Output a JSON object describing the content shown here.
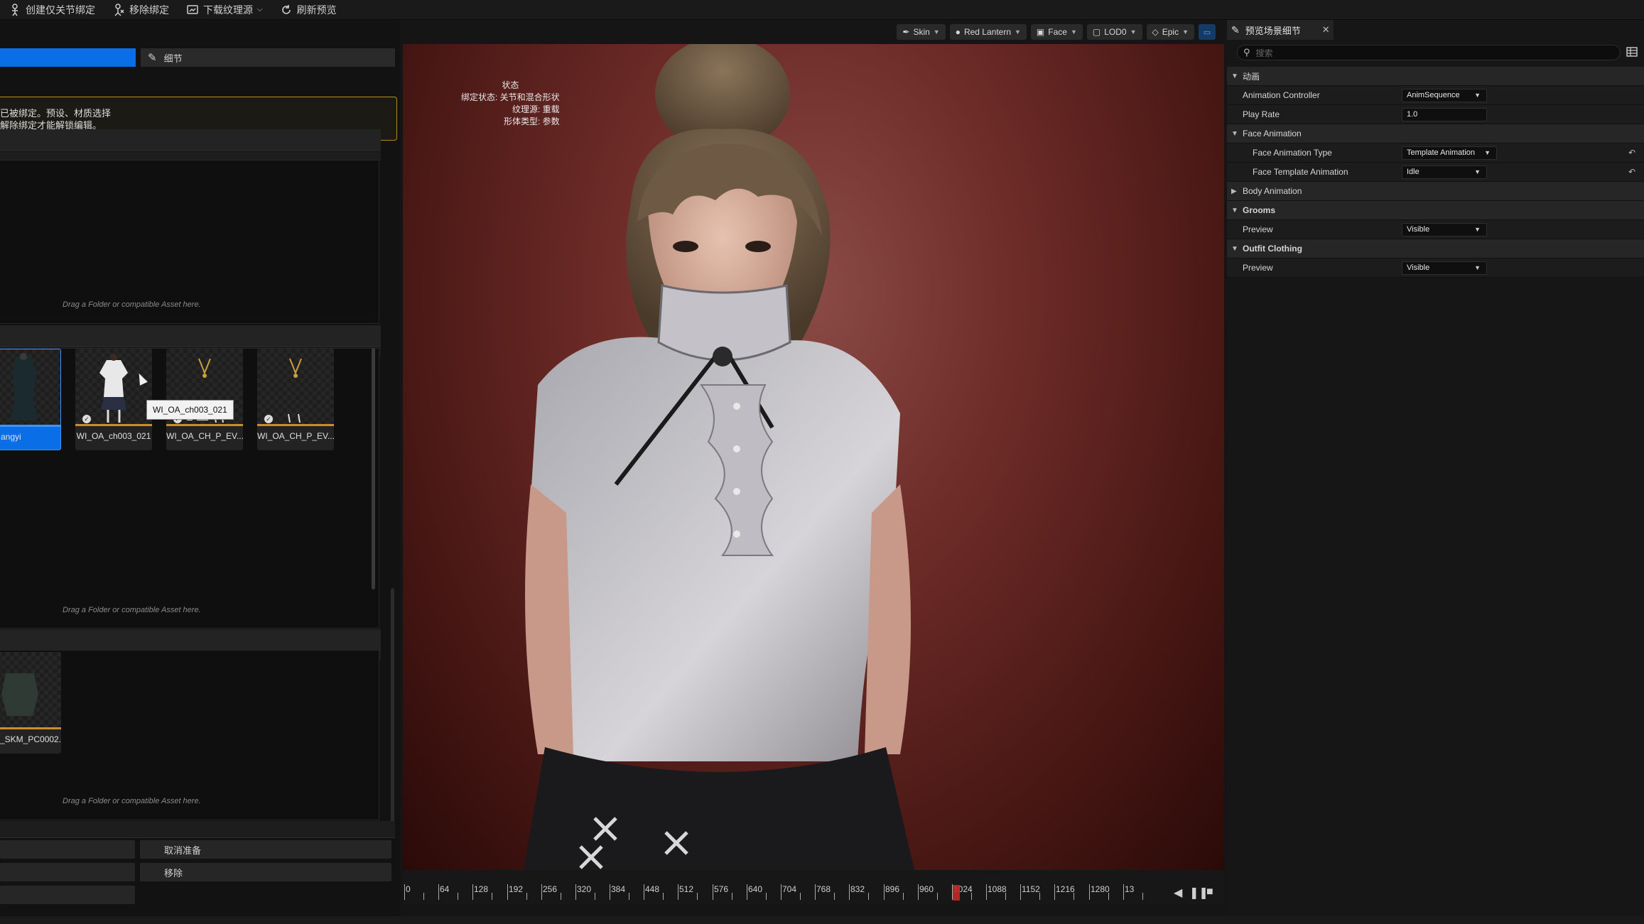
{
  "toolbar": {
    "items": [
      {
        "label": "创建仅关节绑定",
        "icon": "skeleton-icon"
      },
      {
        "label": "移除绑定",
        "icon": "unbind-icon"
      },
      {
        "label": "下载纹理源",
        "icon": "texture-icon",
        "dropdown": true
      },
      {
        "label": "刷新预览",
        "icon": "refresh-icon"
      }
    ]
  },
  "left_panel": {
    "detail_tab_label": "细节",
    "warning_lines": [
      "已被绑定。预设、材质选择",
      "解除绑定才能解锁编辑。"
    ],
    "drop_hint": "Drag a Folder or compatible Asset here.",
    "assets": [
      {
        "label": "angyi",
        "selected": true
      },
      {
        "label": "WI_OA_ch003_021",
        "selected": false
      },
      {
        "label": "WI_OA_CH_P_EV...",
        "selected": false
      },
      {
        "label": "WI_OA_CH_P_EV...",
        "selected": false
      }
    ],
    "tooltip": "WI_OA_ch003_021",
    "body_asset_label": "_SKM_PC0002...",
    "buttons": {
      "unprepare": "取消准备",
      "remove": "移除"
    }
  },
  "viewport": {
    "toolbar": [
      {
        "label": "Skin",
        "icon": "brush-icon"
      },
      {
        "label": "Red Lantern",
        "icon": "lamp-icon"
      },
      {
        "label": "Face",
        "icon": "camera-icon"
      },
      {
        "label": "LOD0",
        "icon": "cube-icon"
      },
      {
        "label": "Epic",
        "icon": "diamond-icon"
      }
    ],
    "stats": {
      "title": "状态",
      "lines": [
        "绑定状态: 关节和混合形状",
        "纹理源: 重载",
        "形体类型: 参数"
      ]
    },
    "timeline": {
      "ticks": [
        "0",
        "64",
        "128",
        "192",
        "256",
        "320",
        "384",
        "448",
        "512",
        "576",
        "640",
        "704",
        "768",
        "832",
        "896",
        "960",
        "1024",
        "1088",
        "1152",
        "1216",
        "1280",
        "13"
      ]
    }
  },
  "details_panel": {
    "tab_label": "预览场景细节",
    "search_placeholder": "搜索",
    "rows": [
      {
        "type": "cat",
        "label": "动画",
        "expanded": true
      },
      {
        "type": "prop",
        "label": "Animation Controller",
        "value": "AnimSequence",
        "dropdown": true
      },
      {
        "type": "prop",
        "label": "Play Rate",
        "value": "1.0",
        "dropdown": false
      },
      {
        "type": "cat-sub",
        "label": "Face Animation",
        "expanded": true
      },
      {
        "type": "prop2",
        "label": "Face Animation Type",
        "value": "Template Animation",
        "dropdown": true,
        "reset": true
      },
      {
        "type": "prop2",
        "label": "Face Template Animation",
        "value": "Idle",
        "dropdown": true,
        "reset": true
      },
      {
        "type": "cat-sub",
        "label": "Body Animation",
        "expanded": false
      },
      {
        "type": "cat",
        "label": "Grooms",
        "expanded": true
      },
      {
        "type": "prop",
        "label": "Preview",
        "value": "Visible",
        "dropdown": true
      },
      {
        "type": "cat",
        "label": "Outfit Clothing",
        "expanded": true
      },
      {
        "type": "prop",
        "label": "Preview",
        "value": "Visible",
        "dropdown": true
      }
    ]
  },
  "colors": {
    "accent": "#0a6fe6",
    "warning_border": "#b58d14",
    "asset_bar": "#d08a2a",
    "playhead": "#c02a2a"
  }
}
